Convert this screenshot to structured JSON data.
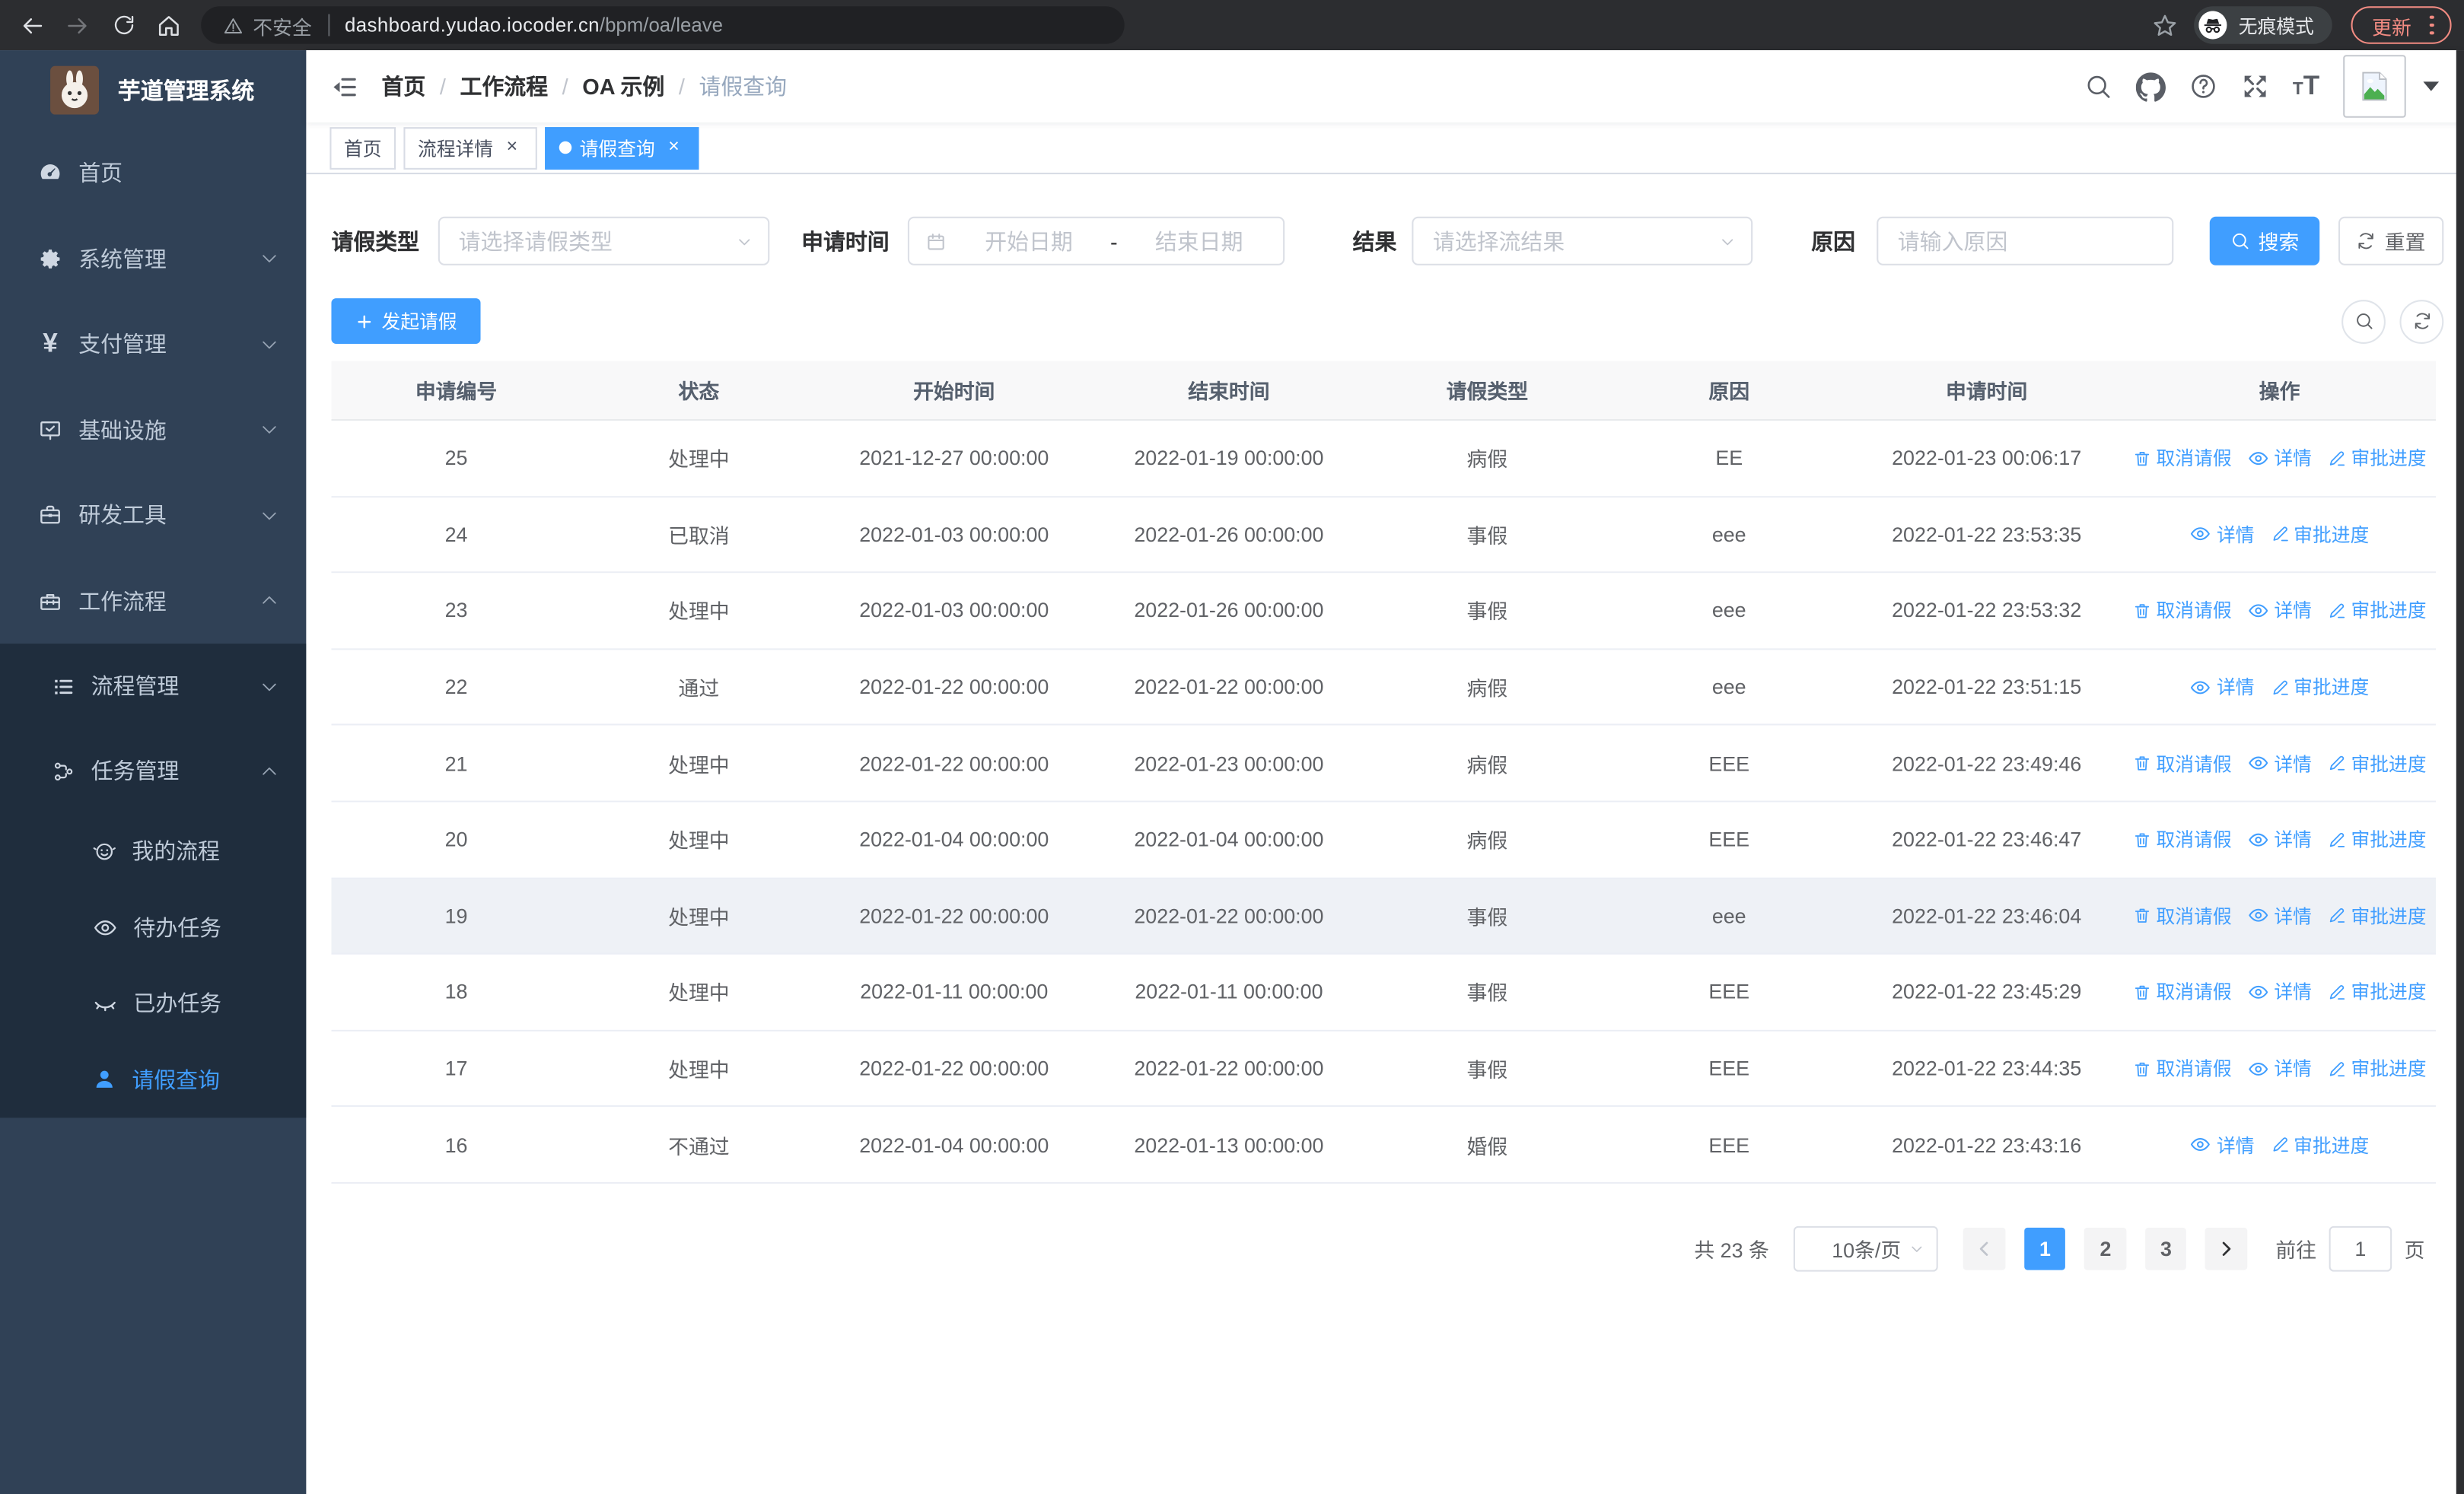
{
  "browser": {
    "security_label": "不安全",
    "url_host": "dashboard.yudao.iocoder.cn",
    "url_path": "/bpm/oa/leave",
    "incognito_label": "无痕模式",
    "update_label": "更新"
  },
  "sidebar": {
    "logo_title": "芋道管理系统",
    "menu": [
      {
        "label": "首页",
        "icon": "gauge-icon",
        "level": 1
      },
      {
        "label": "系统管理",
        "icon": "gear-icon",
        "level": 1,
        "chevron": "down"
      },
      {
        "label": "支付管理",
        "icon": "yen-icon",
        "level": 1,
        "chevron": "down"
      },
      {
        "label": "基础设施",
        "icon": "monitor-icon",
        "level": 1,
        "chevron": "down"
      },
      {
        "label": "研发工具",
        "icon": "briefcase-icon",
        "level": 1,
        "chevron": "down"
      },
      {
        "label": "工作流程",
        "icon": "toolbox-icon",
        "level": 1,
        "chevron": "up"
      }
    ],
    "submenu": [
      {
        "label": "流程管理",
        "icon": "list-icon",
        "level": 2,
        "chevron": "down"
      },
      {
        "label": "任务管理",
        "icon": "flow-icon",
        "level": 2,
        "chevron": "up"
      },
      {
        "label": "我的流程",
        "icon": "face-icon",
        "level": 3
      },
      {
        "label": "待办任务",
        "icon": "eye-open-icon",
        "level": 3
      },
      {
        "label": "已办任务",
        "icon": "eye-closed-icon",
        "level": 3
      },
      {
        "label": "请假查询",
        "icon": "user-icon",
        "level": 3,
        "active": true
      }
    ]
  },
  "header": {
    "breadcrumb": [
      "首页",
      "工作流程",
      "OA 示例",
      "请假查询"
    ]
  },
  "tabs": [
    {
      "label": "首页",
      "closable": false,
      "active": false
    },
    {
      "label": "流程详情",
      "closable": true,
      "active": false
    },
    {
      "label": "请假查询",
      "closable": true,
      "active": true
    }
  ],
  "filters": {
    "leave_type_label": "请假类型",
    "leave_type_placeholder": "请选择请假类型",
    "apply_time_label": "申请时间",
    "date_start_placeholder": "开始日期",
    "date_separator": "-",
    "date_end_placeholder": "结束日期",
    "result_label": "结果",
    "result_placeholder": "请选择流结果",
    "reason_label": "原因",
    "reason_placeholder": "请输入原因",
    "search_label": "搜索",
    "reset_label": "重置"
  },
  "toolbar": {
    "create_label": "发起请假"
  },
  "table": {
    "columns": [
      "申请编号",
      "状态",
      "开始时间",
      "结束时间",
      "请假类型",
      "原因",
      "申请时间",
      "操作"
    ],
    "action_labels": {
      "cancel": "取消请假",
      "detail": "详情",
      "progress": "审批进度"
    },
    "rows": [
      {
        "id": "25",
        "status": "处理中",
        "start": "2021-12-27 00:00:00",
        "end": "2022-01-19 00:00:00",
        "type": "病假",
        "reason": "EE",
        "applied": "2022-01-23 00:06:17",
        "actions": [
          "cancel",
          "detail",
          "progress"
        ],
        "highlighted": false
      },
      {
        "id": "24",
        "status": "已取消",
        "start": "2022-01-03 00:00:00",
        "end": "2022-01-26 00:00:00",
        "type": "事假",
        "reason": "eee",
        "applied": "2022-01-22 23:53:35",
        "actions": [
          "detail",
          "progress"
        ],
        "highlighted": false
      },
      {
        "id": "23",
        "status": "处理中",
        "start": "2022-01-03 00:00:00",
        "end": "2022-01-26 00:00:00",
        "type": "事假",
        "reason": "eee",
        "applied": "2022-01-22 23:53:32",
        "actions": [
          "cancel",
          "detail",
          "progress"
        ],
        "highlighted": false
      },
      {
        "id": "22",
        "status": "通过",
        "start": "2022-01-22 00:00:00",
        "end": "2022-01-22 00:00:00",
        "type": "病假",
        "reason": "eee",
        "applied": "2022-01-22 23:51:15",
        "actions": [
          "detail",
          "progress"
        ],
        "highlighted": false
      },
      {
        "id": "21",
        "status": "处理中",
        "start": "2022-01-22 00:00:00",
        "end": "2022-01-23 00:00:00",
        "type": "病假",
        "reason": "EEE",
        "applied": "2022-01-22 23:49:46",
        "actions": [
          "cancel",
          "detail",
          "progress"
        ],
        "highlighted": false
      },
      {
        "id": "20",
        "status": "处理中",
        "start": "2022-01-04 00:00:00",
        "end": "2022-01-04 00:00:00",
        "type": "病假",
        "reason": "EEE",
        "applied": "2022-01-22 23:46:47",
        "actions": [
          "cancel",
          "detail",
          "progress"
        ],
        "highlighted": false
      },
      {
        "id": "19",
        "status": "处理中",
        "start": "2022-01-22 00:00:00",
        "end": "2022-01-22 00:00:00",
        "type": "事假",
        "reason": "eee",
        "applied": "2022-01-22 23:46:04",
        "actions": [
          "cancel",
          "detail",
          "progress"
        ],
        "highlighted": true
      },
      {
        "id": "18",
        "status": "处理中",
        "start": "2022-01-11 00:00:00",
        "end": "2022-01-11 00:00:00",
        "type": "事假",
        "reason": "EEE",
        "applied": "2022-01-22 23:45:29",
        "actions": [
          "cancel",
          "detail",
          "progress"
        ],
        "highlighted": false
      },
      {
        "id": "17",
        "status": "处理中",
        "start": "2022-01-22 00:00:00",
        "end": "2022-01-22 00:00:00",
        "type": "事假",
        "reason": "EEE",
        "applied": "2022-01-22 23:44:35",
        "actions": [
          "cancel",
          "detail",
          "progress"
        ],
        "highlighted": false
      },
      {
        "id": "16",
        "status": "不通过",
        "start": "2022-01-04 00:00:00",
        "end": "2022-01-13 00:00:00",
        "type": "婚假",
        "reason": "EEE",
        "applied": "2022-01-22 23:43:16",
        "actions": [
          "detail",
          "progress"
        ],
        "highlighted": false
      }
    ]
  },
  "pagination": {
    "total_label": "共 23 条",
    "page_size": "10条/页",
    "pages": [
      "1",
      "2",
      "3"
    ],
    "active_page": "1",
    "goto_label": "前往",
    "goto_value": "1",
    "goto_suffix": "页"
  },
  "colors": {
    "accent": "#409eff",
    "sidebar_bg": "#304156",
    "submenu_bg": "#1f2d3d",
    "update_coral": "#f28b82"
  }
}
